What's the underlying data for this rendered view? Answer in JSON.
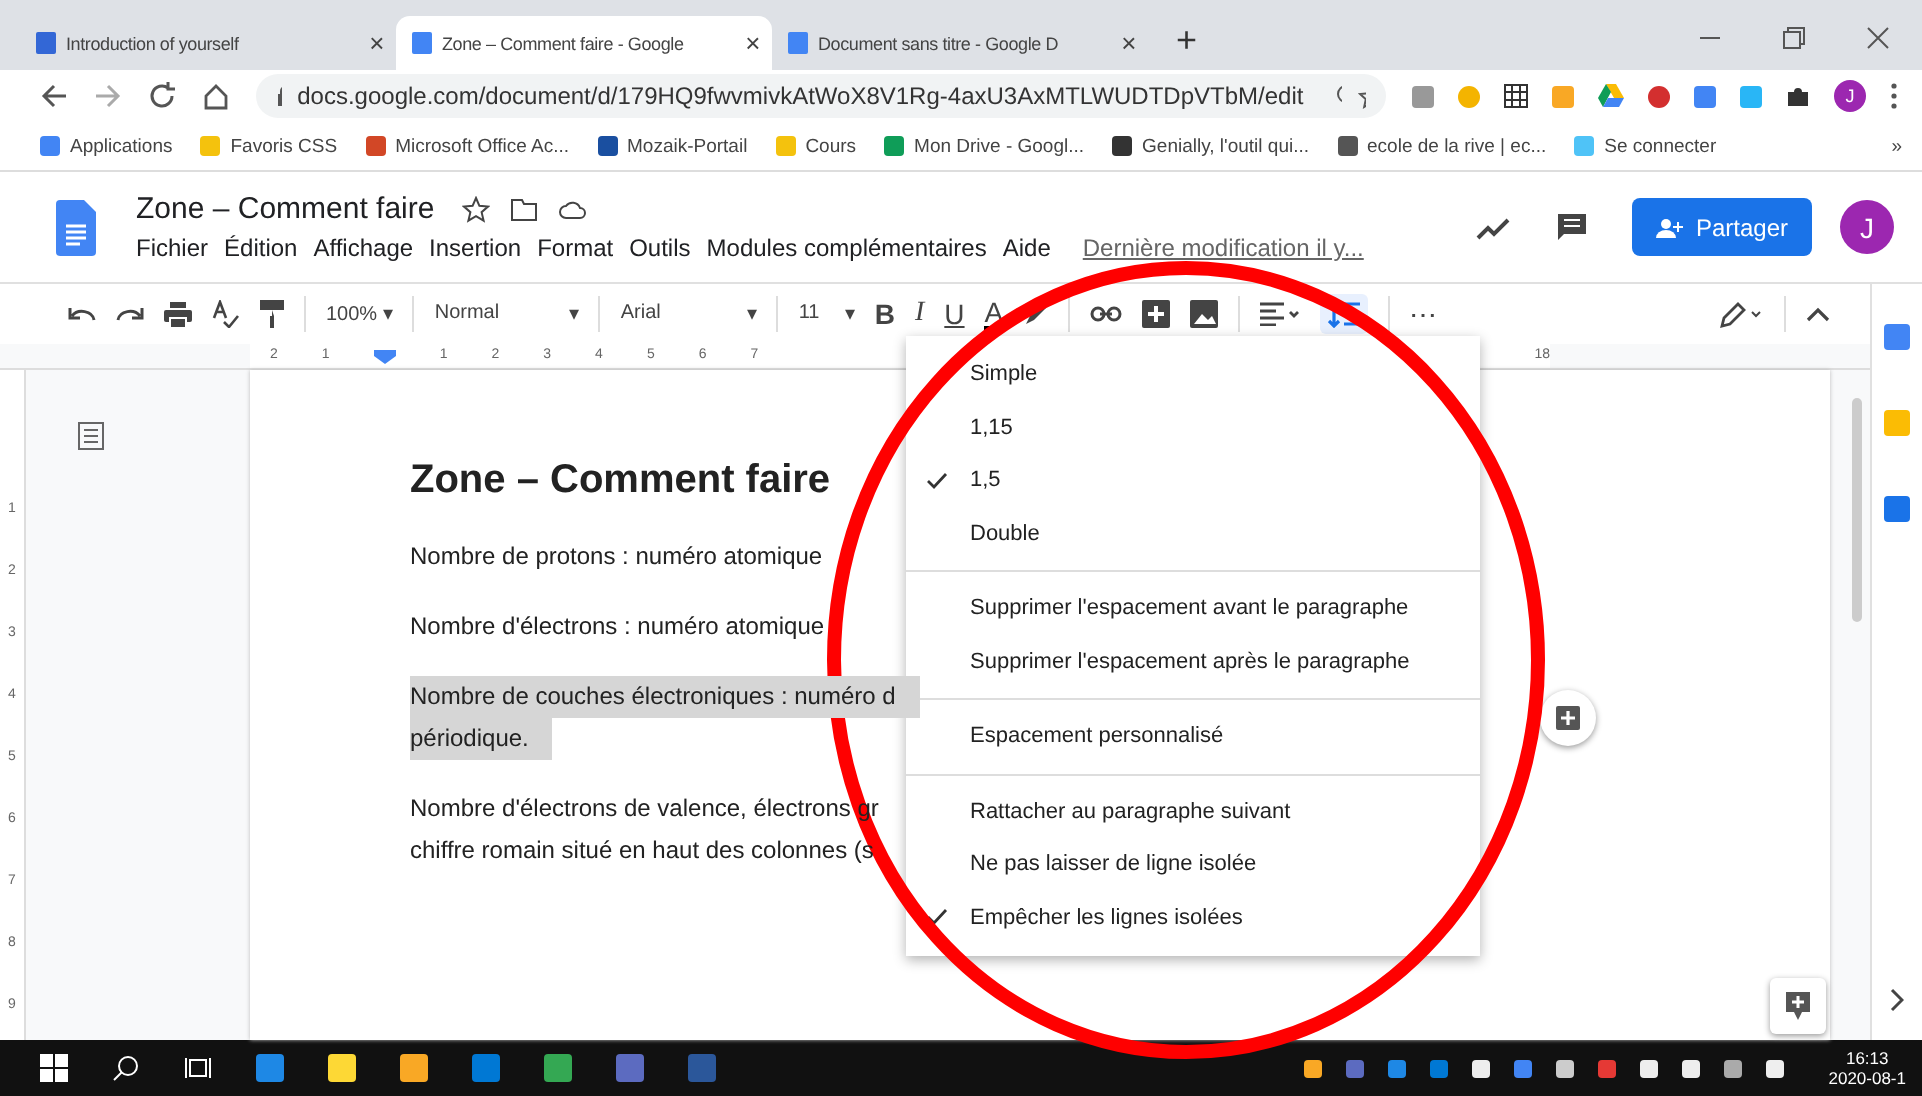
{
  "browser": {
    "tabs": [
      {
        "title": "Introduction of yourself",
        "selected": false,
        "close": "×"
      },
      {
        "title": "Zone – Comment faire - Google",
        "selected": true,
        "close": "×"
      },
      {
        "title": "Document sans titre - Google D",
        "selected": false,
        "close": "×"
      }
    ],
    "new_tab": "+",
    "url": "docs.google.com/document/d/179HQ9fwvmivkAtWoX8V1Rg-4axU3AxMTLWUDTDpVTbM/edit",
    "profile": "J",
    "bookmarks": [
      {
        "label": "Applications",
        "color": "#4285f4"
      },
      {
        "label": "Favoris CSS",
        "color": "#f4c20d"
      },
      {
        "label": "Microsoft Office Ac...",
        "color": "#d24726"
      },
      {
        "label": "Mozaik-Portail",
        "color": "#1a4fa0"
      },
      {
        "label": "Cours",
        "color": "#f4c20d"
      },
      {
        "label": "Mon Drive - Googl...",
        "color": "#0f9d58"
      },
      {
        "label": "Genially, l'outil qui...",
        "color": "#333333"
      },
      {
        "label": "ecole de la rive | ec...",
        "color": "#555555"
      },
      {
        "label": "Se connecter",
        "color": "#4fc3f7"
      }
    ],
    "bookmarks_more": "»"
  },
  "docs": {
    "title": "Zone – Comment faire",
    "menu": [
      "Fichier",
      "Édition",
      "Affichage",
      "Insertion",
      "Format",
      "Outils",
      "Modules complémentaires",
      "Aide"
    ],
    "last_edit": "Dernière modification il y...",
    "share": "Partager",
    "avatar": "J",
    "toolbar": {
      "caret": "▾",
      "zoom": "100%",
      "style": "Normal",
      "font": "Arial",
      "size": "11",
      "format": [
        "B",
        "I",
        "U",
        "A"
      ],
      "line_spacing": {
        "selected": true
      },
      "more": "⋯"
    },
    "ruler": [
      "2",
      "1",
      "1",
      "2",
      "3",
      "4",
      "5",
      "6",
      "7"
    ],
    "ruler_end": "18",
    "vruler": [
      "1",
      "2",
      "3",
      "4",
      "5",
      "6",
      "7",
      "8",
      "9"
    ],
    "document": {
      "heading": "Zone – Comment faire",
      "paragraphs": [
        {
          "lines": [
            "Nombre de protons : numéro atomique"
          ],
          "highlighted": false
        },
        {
          "lines": [
            "Nombre d'électrons : numéro atomique"
          ],
          "highlighted": false
        },
        {
          "lines": [
            "Nombre de couches électroniques : numéro d",
            "périodique."
          ],
          "highlighted": true
        },
        {
          "lines": [
            "Nombre d'électrons de valence, électrons gr",
            "chiffre romain situé en haut des colonnes (s"
          ],
          "highlighted": false
        }
      ]
    },
    "spacing_menu": [
      {
        "kind": "option",
        "label": "Simple",
        "checked": false
      },
      {
        "kind": "option",
        "label": "1,15",
        "checked": false
      },
      {
        "kind": "option",
        "label": "1,5",
        "checked": true
      },
      {
        "kind": "option",
        "label": "Double",
        "checked": false
      },
      {
        "kind": "separator"
      },
      {
        "kind": "option",
        "label": "Supprimer l'espacement avant le paragraphe",
        "checked": false
      },
      {
        "kind": "option",
        "label": "Supprimer l'espacement après le paragraphe",
        "checked": false
      },
      {
        "kind": "separator"
      },
      {
        "kind": "option",
        "label": "Espacement personnalisé",
        "checked": false
      },
      {
        "kind": "separator"
      },
      {
        "kind": "option",
        "label": "Rattacher au paragraphe suivant",
        "checked": false
      },
      {
        "kind": "option",
        "label": "Ne pas laisser de ligne isolée",
        "checked": false
      },
      {
        "kind": "option",
        "label": "Empêcher les lignes isolées",
        "checked": true
      }
    ]
  },
  "annotation": {
    "kind": "ellipse",
    "color": "#ff0000"
  },
  "taskbar": {
    "time": "16:13",
    "date": "2020-08-1"
  }
}
